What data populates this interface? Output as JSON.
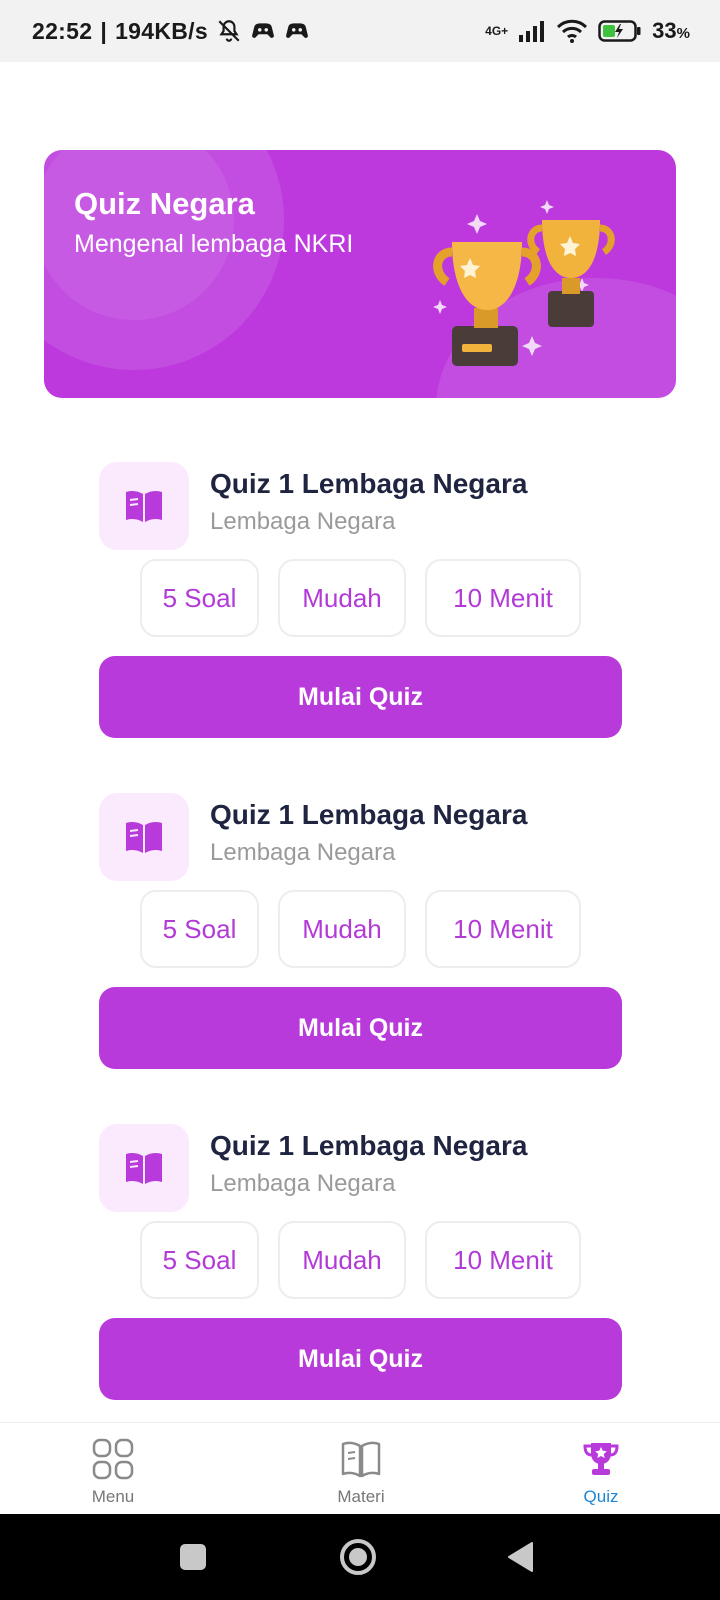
{
  "status_bar": {
    "time": "22:52",
    "speed": "194KB/s",
    "network": "4G+",
    "battery": "33",
    "battery_unit": "%"
  },
  "banner": {
    "title": "Quiz Negara",
    "subtitle": "Mengenal lembaga NKRI",
    "illustration": "trophy-icon"
  },
  "quizzes": [
    {
      "title": "Quiz 1 Lembaga Negara",
      "subtitle": "Lembaga Negara",
      "questions": "5 Soal",
      "difficulty": "Mudah",
      "duration": "10 Menit",
      "button": "Mulai Quiz"
    },
    {
      "title": "Quiz 1 Lembaga Negara",
      "subtitle": "Lembaga Negara",
      "questions": "5 Soal",
      "difficulty": "Mudah",
      "duration": "10 Menit",
      "button": "Mulai Quiz"
    },
    {
      "title": "Quiz 1 Lembaga Negara",
      "subtitle": "Lembaga Negara",
      "questions": "5 Soal",
      "difficulty": "Mudah",
      "duration": "10 Menit",
      "button": "Mulai Quiz"
    }
  ],
  "bottom_nav": [
    {
      "label": "Menu",
      "icon": "grid-icon",
      "active": false
    },
    {
      "label": "Materi",
      "icon": "book-icon",
      "active": false
    },
    {
      "label": "Quiz",
      "icon": "trophy-icon",
      "active": true
    }
  ],
  "colors": {
    "accent": "#b93ada",
    "icon_bg": "#fbe9fd",
    "title_text": "#1f2440",
    "active_nav": "#1e86d6"
  }
}
